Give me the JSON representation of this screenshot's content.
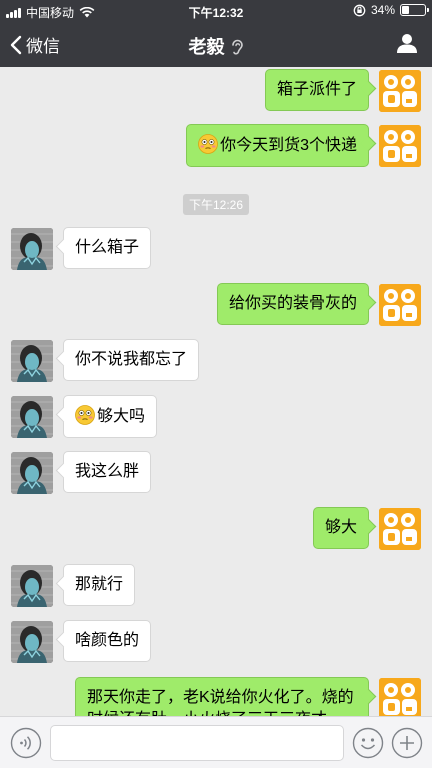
{
  "status_bar": {
    "carrier": "中国移动",
    "time": "下午12:32",
    "battery_percent": "34%",
    "battery_level": 0.34
  },
  "nav": {
    "back_label": "微信",
    "title": "老毅"
  },
  "messages": [
    {
      "from": "self",
      "text": "箱子派件了"
    },
    {
      "from": "self",
      "text": "你今天到货3个快递",
      "emoji": "flushed-emoji"
    },
    {
      "from": "system",
      "text": "下午12:26"
    },
    {
      "from": "other",
      "text": "什么箱子"
    },
    {
      "from": "self",
      "text": "给你买的装骨灰的"
    },
    {
      "from": "other",
      "text": "你不说我都忘了"
    },
    {
      "from": "other",
      "text": "够大吗",
      "emoji": "flushed-emoji"
    },
    {
      "from": "other",
      "text": "我这么胖"
    },
    {
      "from": "self",
      "text": "够大"
    },
    {
      "from": "other",
      "text": "那就行"
    },
    {
      "from": "other",
      "text": "啥颜色的"
    },
    {
      "from": "self",
      "text": "那天你走了，老K说给你火化了。烧的时候还有肚，小火烧了三天三夜才"
    }
  ],
  "colors": {
    "topbar": "#393a3f",
    "chat_background": "#ebebeb",
    "self_bubble": "#9feb6a",
    "other_bubble": "#ffffff",
    "self_avatar": "#f7a81b"
  },
  "input_bar": {
    "value": "",
    "placeholder": ""
  },
  "icons": [
    "back-chevron-icon",
    "ear-icon",
    "profile-icon",
    "voice-icon",
    "emoji-icon",
    "plus-icon",
    "wifi-icon",
    "rotation-lock-icon"
  ]
}
